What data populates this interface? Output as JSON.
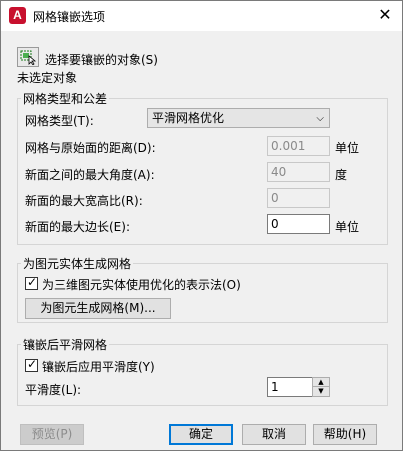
{
  "window": {
    "app_icon_letter": "A",
    "title": "网格镶嵌选项",
    "close_glyph": "✕"
  },
  "select_objects": {
    "label": "选择要镶嵌的对象(S)",
    "status": "未选定对象"
  },
  "mesh_type_group": {
    "title": "网格类型和公差",
    "mesh_type_label": "网格类型(T):",
    "mesh_type_value": "平滑网格优化",
    "distance_label": "网格与原始面的距离(D):",
    "distance_value": "0.001",
    "distance_unit": "单位",
    "angle_label": "新面之间的最大角度(A):",
    "angle_value": "40",
    "angle_unit": "度",
    "aspect_label": "新面的最大宽高比(R):",
    "aspect_value": "0",
    "edge_label": "新面的最大边长(E):",
    "edge_value": "0",
    "edge_unit": "单位"
  },
  "primitive_group": {
    "title": "为图元实体生成网格",
    "optimized_checkbox_label": "为三维图元实体使用优化的表示法(O)",
    "optimized_checked": true,
    "generate_button": "为图元生成网格(M)..."
  },
  "smooth_group": {
    "title": "镶嵌后平滑网格",
    "apply_smooth_label": "镶嵌后应用平滑度(Y)",
    "apply_smooth_checked": true,
    "smoothness_label": "平滑度(L):",
    "smoothness_value": "1"
  },
  "buttons": {
    "preview": "预览(P)",
    "ok": "确定",
    "cancel": "取消",
    "help": "帮助(H)"
  }
}
